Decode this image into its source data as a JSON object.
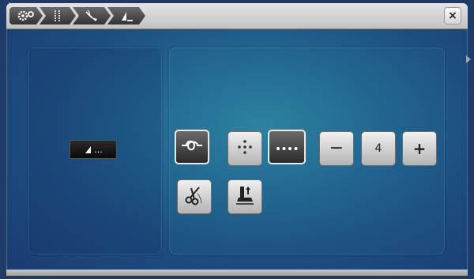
{
  "titlebar": {
    "crumbs": [
      {
        "icon": "gears-icon"
      },
      {
        "icon": "stitch-lines-icon"
      },
      {
        "icon": "needle-thread-icon"
      },
      {
        "icon": "stitch-triangle-icon"
      }
    ],
    "close_label": "×"
  },
  "preview": {
    "icon": "stitch-preview-icon",
    "label": "..."
  },
  "controls": {
    "tie_off": {
      "icon": "knot-icon",
      "active": true
    },
    "pattern_center": {
      "icon": "dots-cross-icon",
      "active": false
    },
    "pattern_repeat": {
      "icon": "four-dots-icon",
      "active": true
    },
    "decrease_label": "−",
    "count_value": "4",
    "increase_label": "+",
    "thread_cut": {
      "icon": "scissors-icon"
    },
    "presser_foot": {
      "icon": "presser-foot-up-icon"
    }
  }
}
